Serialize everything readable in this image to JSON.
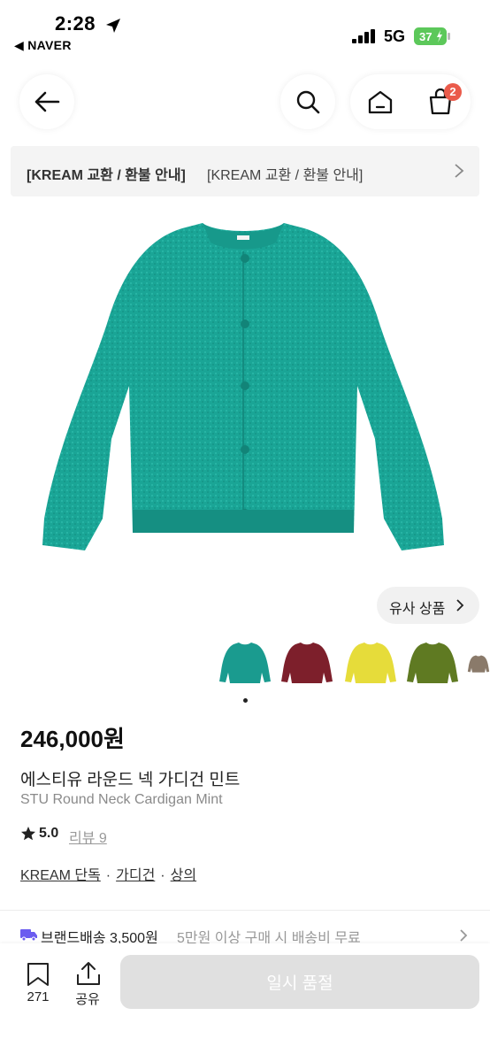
{
  "status_bar": {
    "time": "2:28",
    "back_app": "◀ NAVER",
    "network": "5G",
    "battery": "37"
  },
  "header": {
    "cart_count": "2"
  },
  "notice": {
    "tag": "[KREAM 교환 / 환불 안내]",
    "text": "[KREAM 교환 / 환불 안내]"
  },
  "gallery": {
    "similar_label": "유사 상품",
    "thumbnail_colors": [
      "#1a9b8f",
      "#7d1f2b",
      "#e6dc3a",
      "#5f7a22",
      "#8a7a6a"
    ],
    "main_color": "#1aa596"
  },
  "product": {
    "price": "246,000원",
    "name_ko": "에스티유 라운드 넥 가디건 민트",
    "name_en": "STU Round Neck Cardigan Mint",
    "rating": "5.0",
    "review_label": "리뷰 9",
    "tags": [
      "KREAM 단독",
      "가디건",
      "상의"
    ],
    "tag_separator": "·"
  },
  "shipping": {
    "label": "브랜드배송 3,500원",
    "sub": "5만원 이상 구매 시 배송비 무료"
  },
  "bottom_bar": {
    "bookmark_count": "271",
    "share_label": "공유",
    "soldout_label": "일시 품절"
  }
}
